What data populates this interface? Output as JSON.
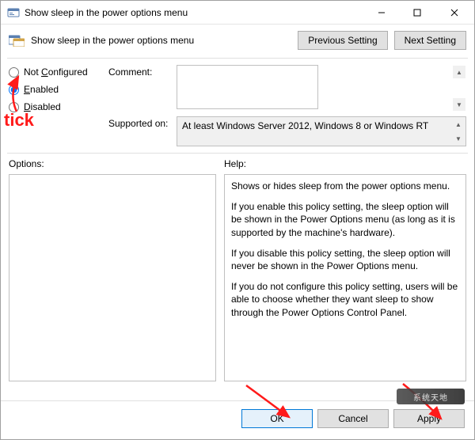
{
  "titlebar": {
    "title": "Show sleep in the power options menu"
  },
  "header": {
    "title": "Show sleep in the power options menu",
    "previous_label": "Previous Setting",
    "next_label": "Next Setting"
  },
  "config": {
    "radios": {
      "not_configured_prefix": "Not ",
      "not_configured_ul": "C",
      "not_configured_suffix": "onfigured",
      "enabled_ul": "E",
      "enabled_suffix": "nabled",
      "disabled_ul": "D",
      "disabled_suffix": "isabled",
      "selected": "enabled"
    },
    "comment_label": "Comment:",
    "comment_value": "",
    "supported_label": "Supported on:",
    "supported_value": "At least Windows Server 2012, Windows 8 or Windows RT"
  },
  "labels": {
    "options": "Options:",
    "help": "Help:"
  },
  "help": {
    "p1": "Shows or hides sleep from the power options menu.",
    "p2": "If you enable this policy setting, the sleep option will be shown in the Power Options menu (as long as it is supported by the machine's hardware).",
    "p3": "If you disable this policy setting, the sleep option will never be shown in the Power Options menu.",
    "p4": "If you do not configure this policy setting, users will be able to choose whether they want sleep to show through the Power Options Control Panel."
  },
  "footer": {
    "ok": "OK",
    "cancel": "Cancel",
    "apply": "Apply"
  },
  "annotations": {
    "tick": "tick"
  },
  "watermark": "系统天地"
}
